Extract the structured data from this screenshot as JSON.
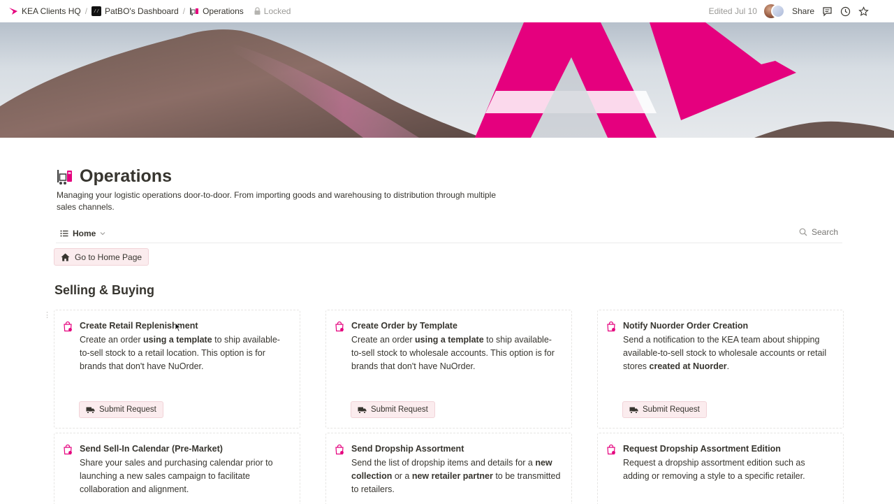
{
  "topbar": {
    "breadcrumbs": [
      {
        "label": "KEA Clients HQ"
      },
      {
        "label": "PatBO's Dashboard"
      },
      {
        "label": "Operations"
      }
    ],
    "locked_label": "Locked",
    "edited_label": "Edited Jul 10",
    "share_label": "Share"
  },
  "page": {
    "title": "Operations",
    "description": "Managing your logistic operations door-to-door. From importing goods and warehousing to distribution through multiple sales channels."
  },
  "view": {
    "tab_label": "Home",
    "search_label": "Search"
  },
  "home_button_label": "Go to Home Page",
  "section": {
    "title": "Selling & Buying"
  },
  "cards": [
    {
      "title": "Create Retail Replenishment",
      "body": [
        {
          "t": "Create an order "
        },
        {
          "t": "using a template",
          "b": true
        },
        {
          "t": " to ship available-to-sell stock to a retail location. This option is for brands that don't have NuOrder."
        }
      ],
      "button": "Submit Request"
    },
    {
      "title": "Create Order by Template",
      "body": [
        {
          "t": "Create an order "
        },
        {
          "t": "using a template",
          "b": true
        },
        {
          "t": " to ship available-to-sell stock to wholesale accounts. This option is for brands that don't have NuOrder."
        }
      ],
      "button": "Submit Request"
    },
    {
      "title": "Notify Nuorder Order Creation",
      "body": [
        {
          "t": "Send a notification to the KEA team about shipping available-to-sell stock to wholesale accounts or retail stores "
        },
        {
          "t": "created at Nuorder",
          "b": true
        },
        {
          "t": "."
        }
      ],
      "button": "Submit Request"
    },
    {
      "title": "Send Sell-In Calendar (Pre-Market)",
      "body": [
        {
          "t": "Share your sales and purchasing calendar prior to launching a new sales campaign to facilitate collaboration and alignment."
        }
      ]
    },
    {
      "title": "Send Dropship Assortment",
      "body": [
        {
          "t": "Send the list of dropship items and details for a "
        },
        {
          "t": "new collection",
          "b": true
        },
        {
          "t": " or a "
        },
        {
          "t": "new retailer partner",
          "b": true
        },
        {
          "t": " to be transmitted to retailers."
        }
      ]
    },
    {
      "title": "Request Dropship Assortment Edition",
      "body": [
        {
          "t": "Request a dropship assortment edition such as adding or removing a style to a specific retailer."
        }
      ]
    }
  ],
  "colors": {
    "brand_pink": "#e5007e",
    "button_bg": "#fbecee",
    "text": "#37352f",
    "muted": "#9b9a97"
  },
  "icons": {
    "card": "shopping-bag-icon",
    "submit": "truck-icon",
    "home": "home-icon",
    "page": "forklift-icon"
  }
}
